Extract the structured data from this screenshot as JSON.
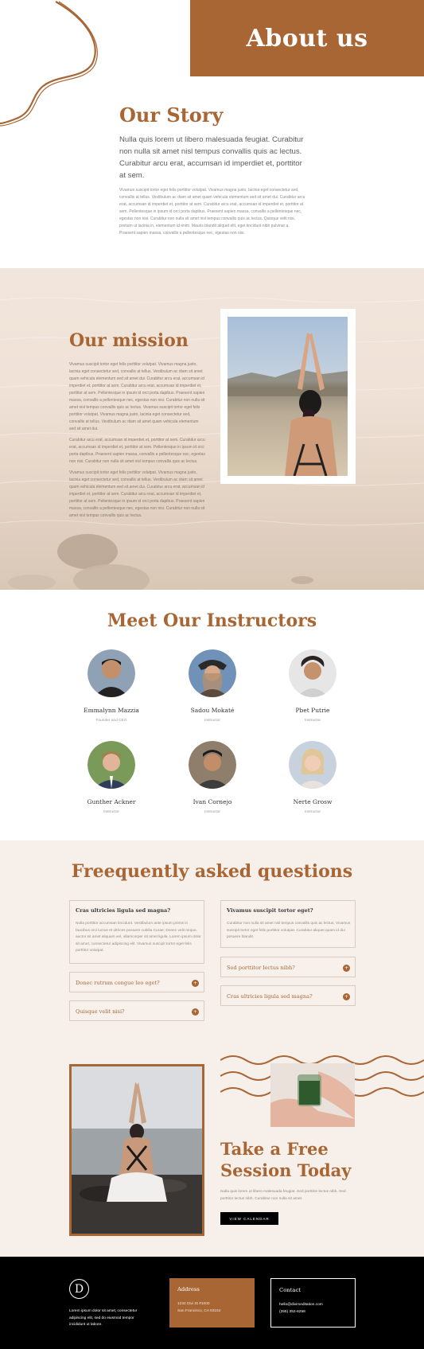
{
  "about": {
    "hero_title": "About us",
    "story_title": "Our Story",
    "story_lead": "Nulla quis lorem ut libero malesuada feugiat. Curabitur non nulla sit amet nisl tempus convallis quis ac lectus. Curabitur arcu erat, accumsan id imperdiet et, porttitor at sem.",
    "story_body": "Vivamus suscipit tortor eget felis porttitor volutpat. Vivamus magna justo, lacinia eget consectetur sed, convallis at tellus. Vestibulum ac diam sit amet quam vehicula elementum sed sit amet dui. Curabitur arcu erat, accumsan id imperdiet et, porttitor at sem. Curabitur arcu erat, accumsan id imperdiet et, porttitor at sem. Pellentesque in ipsum id orci porta dapibus. Praesent sapien massa, convallis a pellentesque nec, egestas non nisi. Curabitur non nulla sit amet nisl tempus convallis quis ac lectus. Quisque velit nisi, pretium ut lacinia in, elementum id enim. Mauris blandit aliquet elit, eget tincidunt nibh pulvinar a. Praesent sapien massa, convallis a pellentesque nec, egestas non nisi."
  },
  "mission": {
    "title": "Our mission",
    "paragraphs": [
      "Vivamus suscipit tortor eget felis porttitor volutpat. Vivamus magna justo, lacinia eget consectetur sed, convallis at tellus. Vestibulum ac diam sit amet quam vehicula elementum sed sit amet dui. Curabitur arcu erat, accumsan id imperdiet et, porttitor at sem. Curabitur arcu erat, accumsan id imperdiet et, porttitor at sem. Pellentesque in ipsum id orci porta dapibus. Praesent sapien massa, convallis a pellentesque nec, egestas non nisi. Curabitur non nulla sit amet nisl tempus convallis quis ac lectus. Vivamus suscipit tortor eget felis porttitor volutpat. Vivamus magna justo, lacinia eget consectetur sed, convallis at tellus. Vestibulum ac diam sit amet quam vehicula elementum sed sit amet dui.",
      "Curabitur arcu erat, accumsan id imperdiet et, porttitor at sem. Curabitur arcu erat, accumsan id imperdiet et, porttitor at sem. Pellentesque in ipsum id orci porta dapibus. Praesent sapien massa, convallis a pellentesque nec, egestas non nisi. Curabitur non nulla sit amet nisl tempus convallis quis ac lectus.",
      "Vivamus suscipit tortor eget felis porttitor volutpat. Vivamus magna justo, lacinia eget consectetur sed, convallis at tellus. Vestibulum ac diam sit amet quam vehicula elementum sed sit amet dui. Curabitur arcu erat, accumsan id imperdiet et, porttitor at sem. Curabitur arcu erat, accumsan id imperdiet et, porttitor at sem. Pellentesque in ipsum id orci porta dapibus. Praesent sapien massa, convallis a pellentesque nec, egestas non nisi. Curabitur non nulla sit amet nisl tempus convallis quis ac lectus."
    ]
  },
  "instructors": {
    "title": "Meet Our Instructors",
    "people": [
      {
        "name": "Emmalynn Mazzia",
        "role": "Founder and CEO"
      },
      {
        "name": "Sadou Mokaté",
        "role": "Instructor"
      },
      {
        "name": "Pbet Putrie",
        "role": "Instructor"
      },
      {
        "name": "Gunther Ackner",
        "role": "Instructor"
      },
      {
        "name": "Ivan Cornejo",
        "role": "Instructor"
      },
      {
        "name": "Nerte Grosw",
        "role": "Instructor"
      }
    ]
  },
  "faq": {
    "title": "Freequently asked questions",
    "items": [
      {
        "q": "Cras ultricies ligula sed magna?",
        "a": "Nulla porttitor accumsan tincidunt. Vestibulum ante ipsum primis in faucibus orci luctus et ultrices posuere cubilia Curae; Donec velit neque, auctor sit amet aliquam vel, ullamcorper sit amet ligula. Lorem ipsum dolor sit amet, consectetur adipiscing elit. Vivamus suscipit tortor eget felis porttitor volutpat."
      },
      {
        "q": "Donec rutrum congue leo eget?"
      },
      {
        "q": "Quisque velit nisi?"
      },
      {
        "q": "Vivamus suscipit tortor eget?",
        "a": "Curabitur non nulla sit amet nisl tempus convallis quis ac lectus. Vivamus suscipit tortor eget felis porttitor volutpat. Curabitur aliquet quam id dui posuere blandit."
      },
      {
        "q": "Sed porttitor lectus nibh?"
      },
      {
        "q": "Cras ultricies ligula sed magna?"
      }
    ]
  },
  "session": {
    "title": "Take a Free Session Today",
    "text": "Nulla quis lorem ut libero malesuada feugiat. Sed porttitor lectus nibh. Sed porttitor lectus nibh. Curabitur non nulla sit amet.",
    "button": "VIEW CALENDAR"
  },
  "footer": {
    "logo_letter": "D",
    "blurb": "Lorem ipsum dolor sit amet, consectetur adipiscing elit, sed do eiusmod tempor incididunt ut labore.",
    "address_title": "Address",
    "address_lines": [
      "1234 Divi St #1000",
      "San Francisco, CA 93152"
    ],
    "contact_title": "Contact",
    "contact_lines": [
      "hello@divimeditation.com",
      "(255) 352-6258"
    ]
  },
  "colors": {
    "accent": "#a86635",
    "faq_bg": "#f7efe9",
    "footer_bg": "#000000"
  }
}
